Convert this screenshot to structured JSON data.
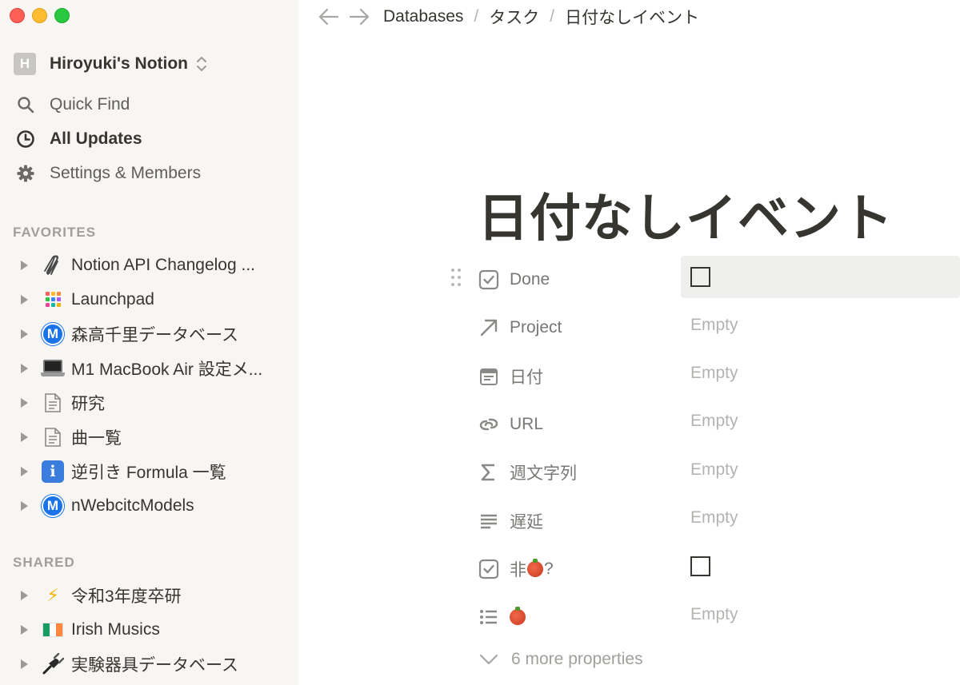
{
  "workspace": {
    "avatar_letter": "H",
    "name": "Hiroyuki's Notion"
  },
  "nav": [
    {
      "label": "Quick Find",
      "icon": "search-icon"
    },
    {
      "label": "All Updates",
      "icon": "clock-icon"
    },
    {
      "label": "Settings & Members",
      "icon": "gear-icon"
    }
  ],
  "favorites": {
    "heading": "FAVORITES",
    "items": [
      {
        "label": "Notion API Changelog ...",
        "icon": "paperclip-icon"
      },
      {
        "label": "Launchpad",
        "icon": "grid-icon"
      },
      {
        "label": "森高千里データベース",
        "icon": "circled-m-icon",
        "icon_text": "M"
      },
      {
        "label": "M1 MacBook Air 設定メ...",
        "icon": "laptop-icon"
      },
      {
        "label": "研究",
        "icon": "page-icon"
      },
      {
        "label": "曲一覧",
        "icon": "page-icon"
      },
      {
        "label": "逆引き Formula 一覧",
        "icon": "info-icon",
        "icon_text": "i"
      },
      {
        "label": "nWebcitcModels",
        "icon": "circled-m-icon",
        "icon_text": "M"
      }
    ]
  },
  "shared": {
    "heading": "SHARED",
    "items": [
      {
        "label": "令和3年度卒研",
        "icon": "lightning-icon",
        "icon_text": "⚡"
      },
      {
        "label": "Irish Musics",
        "icon": "irish-flag-icon"
      },
      {
        "label": "実験器具データベース",
        "icon": "plug-icon"
      }
    ]
  },
  "breadcrumb": [
    "Databases",
    "タスク",
    "日付なしイベント"
  ],
  "page": {
    "title": "日付なしイベント"
  },
  "properties": [
    {
      "name": "Done",
      "icon": "checkbox-icon",
      "type": "checkbox",
      "value": ""
    },
    {
      "name": "Project",
      "icon": "relation-arrow-icon",
      "type": "text",
      "value": "Empty"
    },
    {
      "name": "日付",
      "icon": "calendar-icon",
      "type": "text",
      "value": "Empty"
    },
    {
      "name": "URL",
      "icon": "link-icon",
      "type": "text",
      "value": "Empty"
    },
    {
      "name": "週文字列",
      "icon": "sigma-icon",
      "type": "text",
      "value": "Empty"
    },
    {
      "name": "遅延",
      "icon": "text-lines-icon",
      "type": "text",
      "value": "Empty"
    },
    {
      "name": "非",
      "name_suffix": "?",
      "icon": "checkbox-icon",
      "type": "checkbox",
      "value": ""
    },
    {
      "name": "",
      "icon": "list-icon",
      "type": "text",
      "value": "Empty"
    }
  ],
  "more_properties": "6 more properties",
  "colors": {
    "sidebar_bg": "#f7f6f3",
    "text": "#37352f",
    "muted": "#b4b3b0",
    "row_hover": "#efefed"
  }
}
